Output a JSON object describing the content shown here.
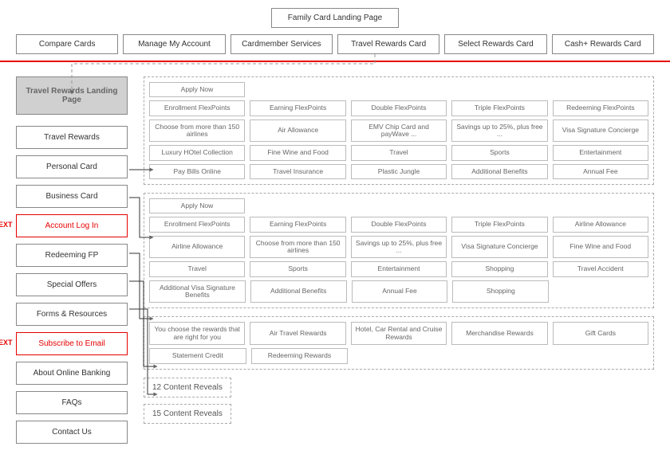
{
  "title": "Family Card Landing Page",
  "topNav": [
    "Compare Cards",
    "Manage My Account",
    "Cardmember Services",
    "Travel Rewards Card",
    "Select Rewards Card",
    "Cash+ Rewards Card"
  ],
  "landing": "Travel Rewards Landing Page",
  "sidebar": [
    {
      "label": "Travel Rewards",
      "ext": false
    },
    {
      "label": "Personal Card",
      "ext": false
    },
    {
      "label": "Business Card",
      "ext": false
    },
    {
      "label": "Account Log In",
      "ext": true
    },
    {
      "label": "Redeeming FP",
      "ext": false
    },
    {
      "label": "Special Offers",
      "ext": false
    },
    {
      "label": "Forms & Resources",
      "ext": false
    },
    {
      "label": "Subscribe to Email",
      "ext": true
    },
    {
      "label": "About Online Banking",
      "ext": false
    },
    {
      "label": "FAQs",
      "ext": false
    },
    {
      "label": "Contact Us",
      "ext": false
    }
  ],
  "extLabel": "EXT",
  "panel1": [
    [
      "Apply Now",
      "",
      "",
      "",
      ""
    ],
    [
      "Enrollment FlexPoints",
      "Earning FlexPoints",
      "Double FlexPoints",
      "Triple FlexPoints",
      "Redeeming FlexPoints"
    ],
    [
      "Choose from more than 150 airlines",
      "Air Allowance",
      "EMV Chip Card and payWave ...",
      "Savings up to 25%, plus free ...",
      "Visa Signature Concierge"
    ],
    [
      "Luxury HOtel Collection",
      "Fine Wine and Food",
      "Travel",
      "Sports",
      "Entertainment"
    ],
    [
      "Pay Bills Online",
      "Travel Insurance",
      "Plastic Jungle",
      "Additional Benefits",
      "Annual Fee"
    ]
  ],
  "panel2": [
    [
      "Apply Now",
      "",
      "",
      "",
      ""
    ],
    [
      "Enrollment FlexPoints",
      "Earning FlexPoints",
      "Double FlexPoints",
      "Triple FlexPoints",
      "Airline Allowance"
    ],
    [
      "Airline Allowance",
      "Choose from more than 150 airlines",
      "Savings up to 25%, plus free ...",
      "Visa Signature Concierge",
      "Fine Wine and Food"
    ],
    [
      "Travel",
      "Sports",
      "Entertainment",
      "Shopping",
      "Travel Accident"
    ],
    [
      "Additional Visa Signature Benefits",
      "Additional Benefits",
      "Annual Fee",
      "Shopping",
      ""
    ]
  ],
  "panel3": [
    [
      "You choose the rewards that are right for you",
      "Air Travel Rewards",
      "Hotel, Car Rental and Cruise Rewards",
      "Merchandise Rewards",
      "Gift Cards"
    ],
    [
      "Statement Credit",
      "Redeeming Rewards",
      "",
      "",
      ""
    ]
  ],
  "reveal1": "12 Content Reveals",
  "reveal2": "15 Content Reveals"
}
